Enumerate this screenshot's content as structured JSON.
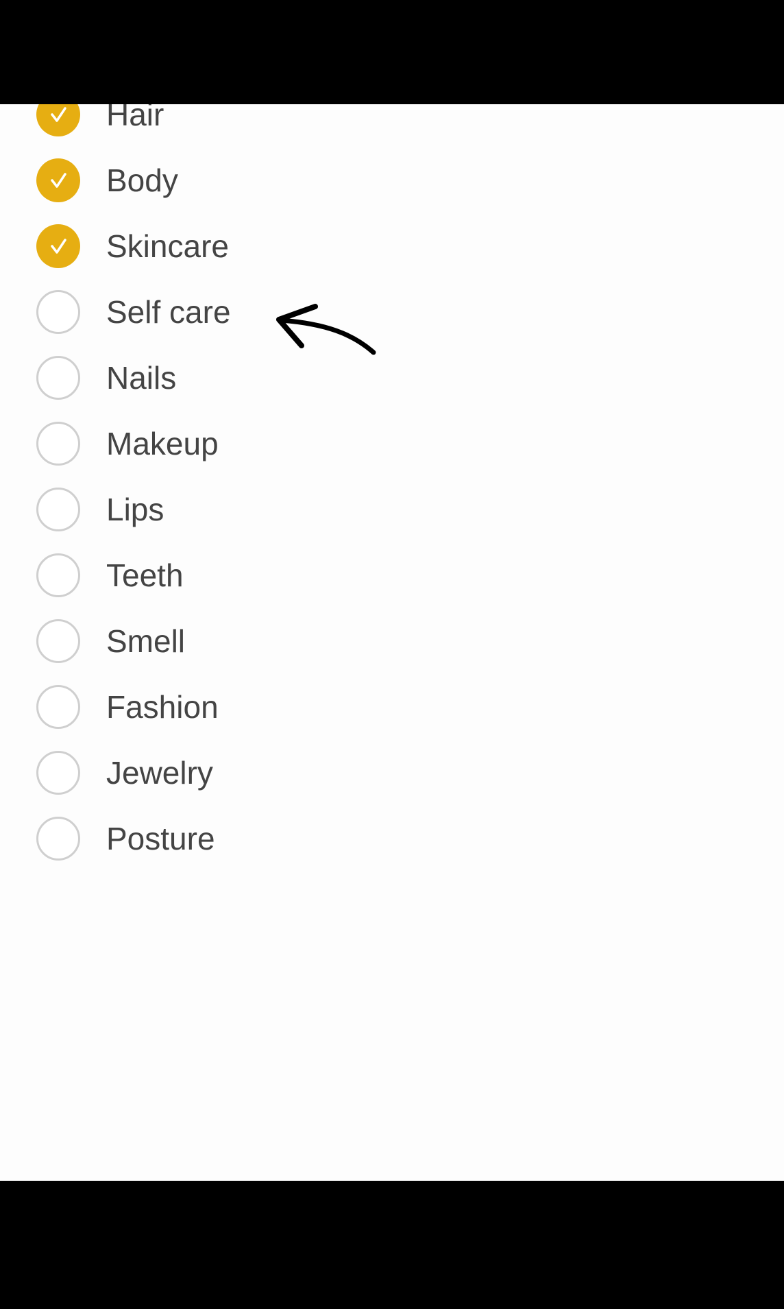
{
  "accent_color": "#e6ae12",
  "items": [
    {
      "label": "Hair",
      "checked": true
    },
    {
      "label": "Body",
      "checked": true
    },
    {
      "label": "Skincare",
      "checked": true
    },
    {
      "label": "Self care",
      "checked": false
    },
    {
      "label": "Nails",
      "checked": false
    },
    {
      "label": "Makeup",
      "checked": false
    },
    {
      "label": "Lips",
      "checked": false
    },
    {
      "label": "Teeth",
      "checked": false
    },
    {
      "label": "Smell",
      "checked": false
    },
    {
      "label": "Fashion",
      "checked": false
    },
    {
      "label": "Jewelry",
      "checked": false
    },
    {
      "label": "Posture",
      "checked": false
    }
  ],
  "annotation": {
    "icon": "hand-drawn-arrow-icon",
    "points_to": "Self care"
  }
}
